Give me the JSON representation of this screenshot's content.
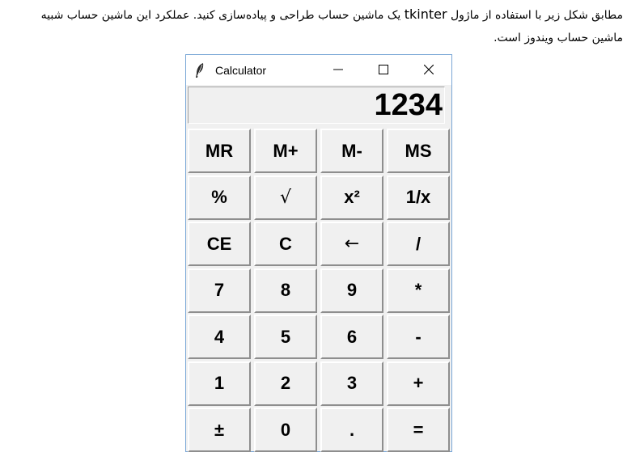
{
  "document": {
    "line1_part1": "مطابق شکل زیر با استفاده از ماژول ",
    "line1_module": "tkinter",
    "line1_part2": " یک ماشین حساب طراحی و پیاده‌سازی کنید. عملکرد این ماشین حساب شبیه",
    "line2": "ماشین حساب ویندوز است."
  },
  "window": {
    "title": "Calculator",
    "title_icon": "feather-icon",
    "controls": [
      "minimize-icon",
      "maximize-icon",
      "close-icon"
    ],
    "border_color": "#7aa7d6"
  },
  "display": {
    "value": "1234"
  },
  "keypad": {
    "rows": [
      [
        "MR",
        "M+",
        "M-",
        "MS"
      ],
      [
        "%",
        "√",
        "x²",
        "1/x"
      ],
      [
        "CE",
        "C",
        "←",
        "/"
      ],
      [
        "7",
        "8",
        "9",
        "*"
      ],
      [
        "4",
        "5",
        "6",
        "-"
      ],
      [
        "1",
        "2",
        "3",
        "+"
      ],
      [
        "±",
        "0",
        ".",
        "="
      ]
    ]
  }
}
